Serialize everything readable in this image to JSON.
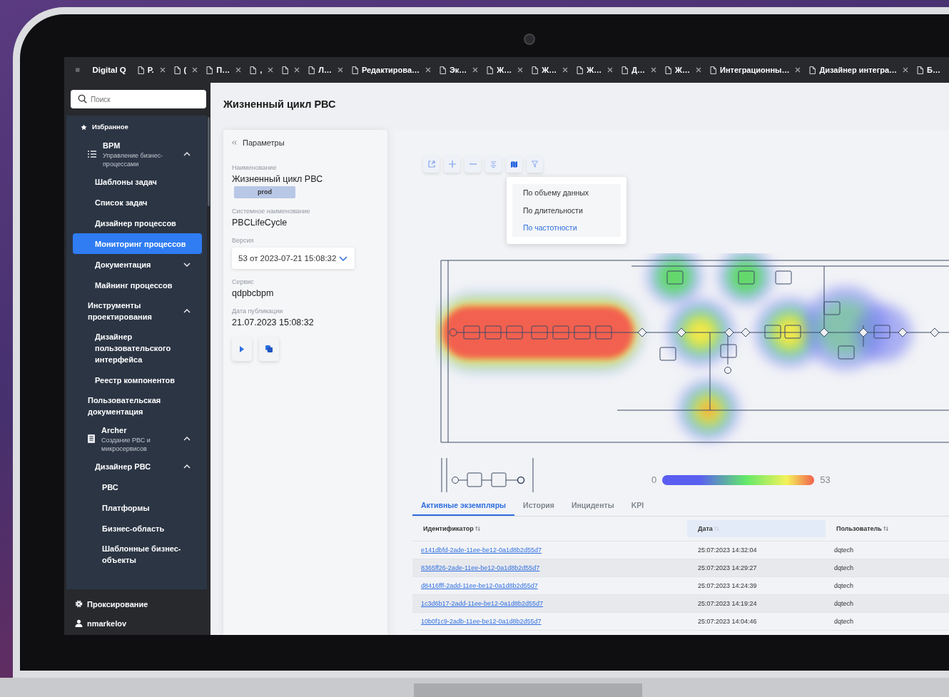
{
  "top_bar": {
    "app_name": "Digital Q",
    "tabs": [
      {
        "label": "Р.",
        "closable": true
      },
      {
        "label": "(",
        "closable": true
      },
      {
        "label": "П…",
        "closable": true
      },
      {
        "label": ",",
        "closable": true
      },
      {
        "closable": true
      },
      {
        "label": "Л…",
        "closable": true
      },
      {
        "label": "Редактирова…",
        "closable": true
      },
      {
        "label": "Эк…",
        "closable": true
      },
      {
        "label": "Ж…",
        "closable": true
      },
      {
        "label": "Ж…",
        "closable": true
      },
      {
        "label": "Ж…",
        "closable": true
      },
      {
        "label": "Д…",
        "closable": true
      },
      {
        "label": "Ж…",
        "closable": true
      },
      {
        "label": "Интеграционны…",
        "closable": true
      },
      {
        "label": "Дизайнер интегра…",
        "closable": true
      },
      {
        "label": "Б…",
        "closable": false
      }
    ]
  },
  "sidebar": {
    "search": {
      "placeholder": "Поиск"
    },
    "items": [
      {
        "kind": "favorites",
        "label": "Избранное",
        "selected": false
      },
      {
        "kind": "module",
        "label": "BPM",
        "subtitle": "Управление бизнес-процессами",
        "selected": false,
        "expanded": true,
        "children": [
          {
            "kind": "link",
            "label": "Шаблоны задач",
            "selected": false
          },
          {
            "kind": "link",
            "label": "Список задач",
            "selected": false
          },
          {
            "kind": "link",
            "label": "Дизайнер процессов",
            "selected": false
          },
          {
            "kind": "link",
            "label": "Мониторинг процессов",
            "selected": true
          },
          {
            "kind": "link",
            "label": "Документация",
            "selected": false,
            "expanded": false
          },
          {
            "kind": "link",
            "label": "Майнинг процессов",
            "selected": false
          }
        ]
      },
      {
        "kind": "link",
        "label": "Инструменты проектирования",
        "selected": false,
        "expanded": true,
        "children": [
          {
            "kind": "link",
            "label": "Дизайнер пользовательского интерфейса",
            "selected": false
          },
          {
            "kind": "link",
            "label": "Реестр компонентов",
            "selected": false
          }
        ]
      },
      {
        "kind": "link",
        "label": "Пользовательская документация",
        "selected": false
      },
      {
        "kind": "module",
        "label": "Archer",
        "subtitle": "Создание РВС и микросервисов",
        "selected": false,
        "expanded": true,
        "children": [
          {
            "kind": "link",
            "label": "Дизайнер РВС",
            "selected": false,
            "expanded": true,
            "children": [
              {
                "kind": "link",
                "label": "РВС",
                "selected": false
              },
              {
                "kind": "link",
                "label": "Платформы",
                "selected": false
              },
              {
                "kind": "link",
                "label": "Бизнес-область",
                "selected": false
              },
              {
                "kind": "link",
                "label": "Шаблонные бизнес-объекты",
                "selected": false
              }
            ]
          }
        ]
      }
    ],
    "footer": [
      {
        "kind": "settings",
        "label": "Проксирование"
      },
      {
        "kind": "user",
        "label": "nmarkelov"
      }
    ]
  },
  "page_title": "Жизненный цикл РВС",
  "params": {
    "header": "Параметры",
    "fields": [
      {
        "kind": "text",
        "label": "Наименование",
        "value": "Жизненный цикл РВС",
        "tag": "prod"
      },
      {
        "kind": "text",
        "label": "Системное наименование",
        "value": "PBCLifeCycle"
      },
      {
        "kind": "select",
        "label": "Версия",
        "value": "53 от 2023-07-21 15:08:32"
      },
      {
        "kind": "text",
        "label": "Сервис",
        "value": "qdpbcbpm"
      },
      {
        "kind": "text",
        "label": "Дата публикации",
        "value": "21.07.2023 15:08:32"
      }
    ],
    "actions": [
      {
        "kind": "run"
      },
      {
        "kind": "copy"
      }
    ]
  },
  "diagram": {
    "toolbar": [
      {
        "kind": "export",
        "selected": false
      },
      {
        "kind": "zoom_in",
        "selected": false
      },
      {
        "kind": "zoom_out",
        "selected": false
      },
      {
        "kind": "align",
        "selected": false
      },
      {
        "kind": "heatmap",
        "selected": true
      },
      {
        "kind": "filter",
        "selected": false
      }
    ],
    "heatmap_menu": {
      "open": true,
      "items": [
        {
          "label": "По объему данных",
          "selected": false
        },
        {
          "label": "По длительности",
          "selected": false
        },
        {
          "label": "По частотности",
          "selected": true
        }
      ]
    },
    "legend": {
      "min": "0",
      "max": "53"
    }
  },
  "instances": {
    "tabs": [
      {
        "label": "Активные экземпляры",
        "selected": true
      },
      {
        "label": "История",
        "selected": false
      },
      {
        "label": "Инциденты",
        "selected": false
      },
      {
        "label": "KPI",
        "selected": false
      }
    ],
    "columns": [
      {
        "label": "Идентификатор",
        "sorted": false
      },
      {
        "label": "Дата",
        "sorted": true
      },
      {
        "label": "Пользователь",
        "sorted": false
      }
    ],
    "rows": [
      {
        "id": "e141dbfd-2ade-11ee-be12-0a1d8b2d55d7",
        "date": "25:07:2023 14:32:04",
        "user": "dqtech"
      },
      {
        "id": "8365ff26-2ade-11ee-be12-0a1d8b2d55d7",
        "date": "25:07:2023 14:29:27",
        "user": "dqtech"
      },
      {
        "id": "d8416fff-2add-11ee-be12-0a1d8b2d55d7",
        "date": "25:07:2023 14:24:39",
        "user": "dqtech"
      },
      {
        "id": "1c3d6b17-2add-11ee-be12-0a1d8b2d55d7",
        "date": "25:07:2023 14:19:24",
        "user": "dqtech"
      },
      {
        "id": "10b0f1c9-2adb-11ee-be12-0a1d8b2d55d7",
        "date": "25:07:2023 14:04:46",
        "user": "dqtech"
      }
    ]
  }
}
